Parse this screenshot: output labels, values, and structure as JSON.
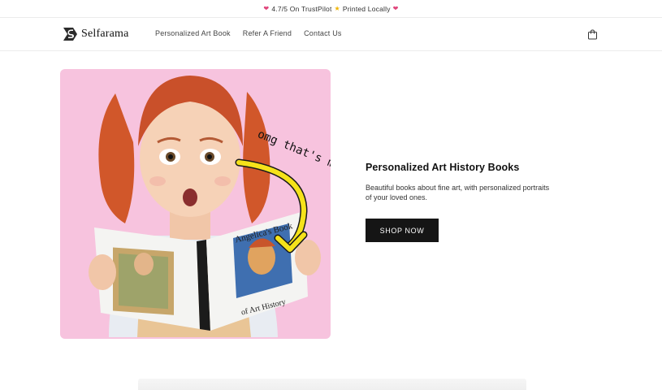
{
  "announcement": {
    "text": "4.7/5 On TrustPilot",
    "text2": "Printed Locally",
    "icon_left": "heart-icon",
    "icon_mid": "star-icon",
    "icon_right": "heart-icon"
  },
  "header": {
    "logo_text": "Selfarama",
    "nav": [
      {
        "label": "Personalized Art Book"
      },
      {
        "label": "Refer A Friend"
      },
      {
        "label": "Contact Us"
      }
    ],
    "cart_icon": "bag-icon"
  },
  "hero": {
    "image_text": {
      "scribble": "omg that's me",
      "book_title_line1": "Angelica's Book",
      "book_title_line2": "of Art History"
    },
    "title": "Personalized Art History Books",
    "description": "Beautiful books about fine art, with personalized portraits of your loved ones.",
    "button_label": "SHOP NOW"
  },
  "colors": {
    "hero_bg": "#f7c3de",
    "button_bg": "#151515",
    "accent_heart": "#e0457b",
    "arrow_yellow": "#f5e21a"
  }
}
